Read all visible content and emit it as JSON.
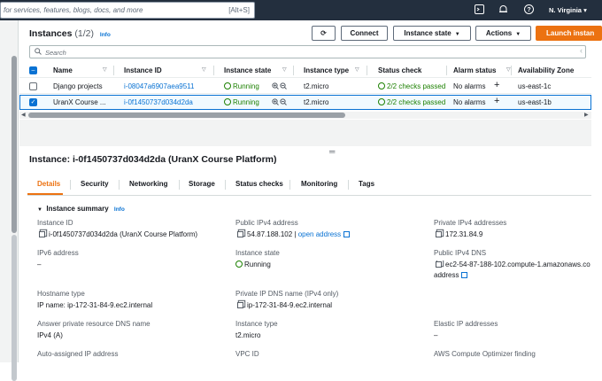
{
  "topbar": {
    "search_placeholder": "for services, features, blogs, docs, and more",
    "search_shortcut": "[Alt+S]",
    "region": "N. Virginia"
  },
  "instances": {
    "title": "Instances",
    "count": "(1/2)",
    "info": "Info",
    "buttons": {
      "connect": "Connect",
      "instance_state": "Instance state",
      "actions": "Actions",
      "launch": "Launch instan"
    },
    "filter_placeholder": "Search",
    "columns": [
      "Name",
      "Instance ID",
      "Instance state",
      "Instance type",
      "Status check",
      "Alarm status",
      "Availability Zone"
    ],
    "rows": [
      {
        "name": "Django projects",
        "instance_id": "i-08047a6907aea9511",
        "state": "Running",
        "type": "t2.micro",
        "status_check": "2/2 checks passed",
        "alarm": "No alarms",
        "zone": "us-east-1c",
        "selected": false
      },
      {
        "name": "UranX Course ...",
        "instance_id": "i-0f1450737d034d2da",
        "state": "Running",
        "type": "t2.micro",
        "status_check": "2/2 checks passed",
        "alarm": "No alarms",
        "zone": "us-east-1b",
        "selected": true
      }
    ]
  },
  "details": {
    "title": "Instance: i-0f1450737d034d2da (UranX Course Platform)",
    "tabs": [
      "Details",
      "Security",
      "Networking",
      "Storage",
      "Status checks",
      "Monitoring",
      "Tags"
    ],
    "summary_title": "Instance summary",
    "summary_info": "Info",
    "fields": {
      "instance_id_label": "Instance ID",
      "instance_id_value": "i-0f1450737d034d2da (UranX Course Platform)",
      "public_ipv4_label": "Public IPv4 address",
      "public_ipv4_value": "54.87.188.102",
      "public_ipv4_link": "open address",
      "private_ipv4_label": "Private IPv4 addresses",
      "private_ipv4_value": "172.31.84.9",
      "ipv6_label": "IPv6 address",
      "ipv6_value": "–",
      "instance_state_label": "Instance state",
      "instance_state_value": "Running",
      "public_dns_label": "Public IPv4 DNS",
      "public_dns_value": "ec2-54-87-188-102.compute-1.amazonaws.co",
      "public_dns_link": "address",
      "hostname_type_label": "Hostname type",
      "hostname_type_value": "IP name: ip-172-31-84-9.ec2.internal",
      "private_dns_label": "Private IP DNS name (IPv4 only)",
      "private_dns_value": "ip-172-31-84-9.ec2.internal",
      "answer_dns_label": "Answer private resource DNS name",
      "answer_dns_value": "IPv4 (A)",
      "instance_type_label": "Instance type",
      "instance_type_value": "t2.micro",
      "elastic_ip_label": "Elastic IP addresses",
      "elastic_ip_value": "–",
      "auto_ip_label": "Auto-assigned IP address",
      "vpc_label": "VPC ID",
      "optimizer_label": "AWS Compute Optimizer finding"
    }
  }
}
